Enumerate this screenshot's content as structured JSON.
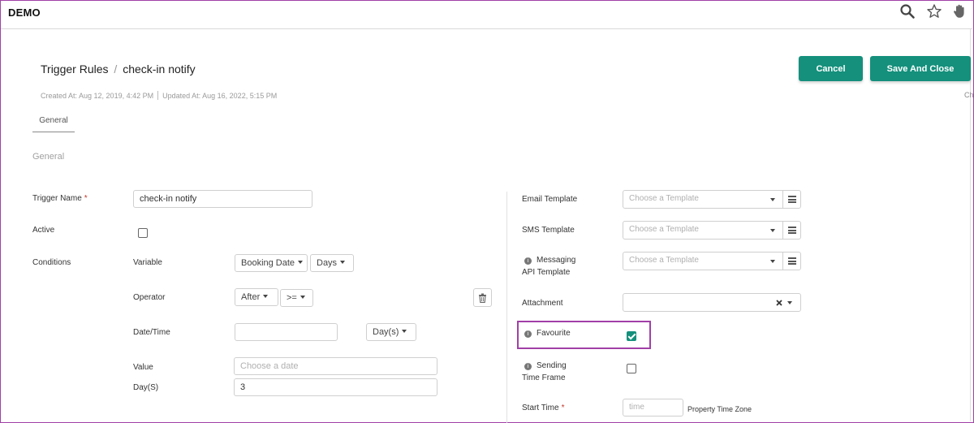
{
  "app": {
    "brand": "DEMO"
  },
  "toolbar": {
    "search_icon": "search-icon",
    "star_icon": "star-icon",
    "hand_icon": "hand-icon"
  },
  "header": {
    "breadcrumb_root": "Trigger Rules",
    "breadcrumb_sep": "/",
    "breadcrumb_current": "check-in notify",
    "created": "Created At: Aug 12, 2019, 4:42 PM",
    "updated": "Updated At: Aug 16, 2022, 5:15 PM",
    "truncated_text": "Ch"
  },
  "actions": {
    "cancel_label": "Cancel",
    "save_close_label": "Save And Close"
  },
  "tabs": [
    {
      "label": "General",
      "active": true
    }
  ],
  "section_title": "General",
  "form_left": {
    "trigger_name_label": "Trigger Name",
    "required_mark": "*",
    "trigger_name_value": "check-in notify",
    "active_label": "Active",
    "active_checked": false,
    "conditions_label": "Conditions",
    "variable_label": "Variable",
    "variable_value": "Booking Date",
    "variable_unit": "Days",
    "operator_label": "Operator",
    "operator_value": "After",
    "operator_compare": ">=",
    "datetime_label": "Date/Time",
    "datetime_value": "",
    "datetime_unit": "Day(s)",
    "value_label": "Value",
    "value_placeholder": "Choose a date",
    "days_label": "Day(S)",
    "days_value": "3"
  },
  "form_right": {
    "email_template_label": "Email Template",
    "sms_template_label": "SMS Template",
    "messaging_label_line1": "Messaging",
    "messaging_label_line2": "API Template",
    "template_placeholder": "Choose a Template",
    "attachment_label": "Attachment",
    "favourite_label": "Favourite",
    "favourite_checked": true,
    "sending_label_line1": "Sending",
    "sending_label_line2": "Time Frame",
    "sending_checked": false,
    "start_time_label": "Start Time",
    "start_time_placeholder": "time",
    "timezone_label": "Property Time Zone"
  },
  "colors": {
    "accent": "#14907c",
    "highlight": "#a13fa7"
  }
}
